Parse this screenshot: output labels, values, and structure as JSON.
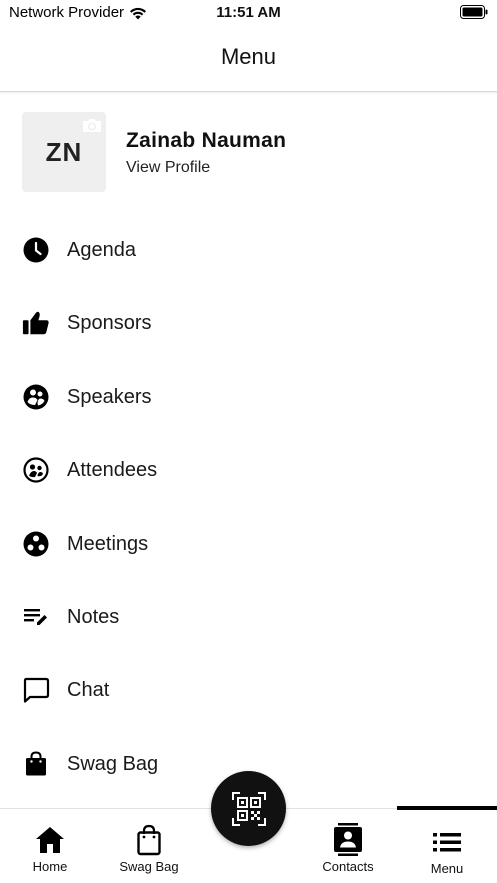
{
  "status_bar": {
    "carrier": "Network Provider",
    "time": "11:51 AM"
  },
  "header": {
    "title": "Menu"
  },
  "profile": {
    "initials": "ZN",
    "name": "Zainab Nauman",
    "link": "View Profile"
  },
  "menu": {
    "items": [
      {
        "label": "Agenda",
        "icon": "clock-icon"
      },
      {
        "label": "Sponsors",
        "icon": "thumbs-up-icon"
      },
      {
        "label": "Speakers",
        "icon": "people-circle-icon"
      },
      {
        "label": "Attendees",
        "icon": "face-circle-icon"
      },
      {
        "label": "Meetings",
        "icon": "group-circle-icon"
      },
      {
        "label": "Notes",
        "icon": "notes-edit-icon"
      },
      {
        "label": "Chat",
        "icon": "chat-bubble-icon"
      },
      {
        "label": "Swag Bag",
        "icon": "shopping-bag-icon"
      }
    ]
  },
  "tabbar": {
    "home": "Home",
    "swag_bag": "Swag Bag",
    "contacts": "Contacts",
    "menu": "Menu",
    "active": "menu"
  },
  "fab": {
    "icon": "qr-scan-icon"
  }
}
